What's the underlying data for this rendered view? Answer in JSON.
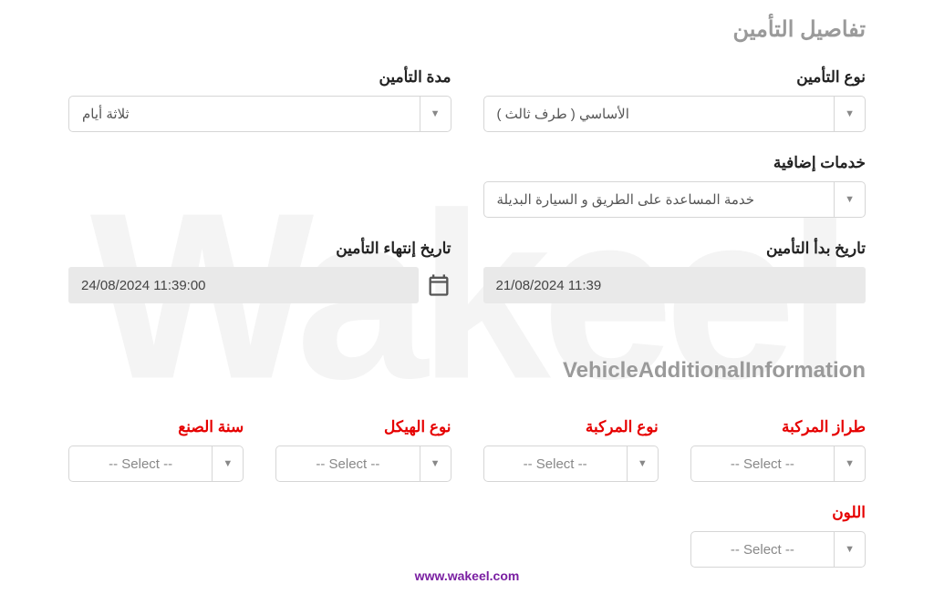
{
  "watermark": "Wakeel",
  "section1_title": "تفاصيل التأمين",
  "insurance_type": {
    "label": "نوع التأمين",
    "value": "الأساسي ( طرف ثالث )"
  },
  "insurance_duration": {
    "label": "مدة التأمين",
    "value": "ثلاثة أيام"
  },
  "additional_services": {
    "label": "خدمات إضافية",
    "value": "خدمة المساعدة على الطريق و السيارة البديلة"
  },
  "start_date": {
    "label": "تاريخ بدأ التأمين",
    "value": "11:39 21/08/2024"
  },
  "end_date": {
    "label": "تاريخ إنتهاء التأمين",
    "value": "11:39:00 24/08/2024"
  },
  "section2_title": "VehicleAdditionalInformation",
  "vehicle_model": {
    "label": "طراز المركبة",
    "placeholder": "-- Select --"
  },
  "vehicle_type": {
    "label": "نوع المركبة",
    "placeholder": "-- Select --"
  },
  "body_type": {
    "label": "نوع الهيكل",
    "placeholder": "-- Select --"
  },
  "manufacture_year": {
    "label": "سنة الصنع",
    "placeholder": "-- Select --"
  },
  "color": {
    "label": "اللون",
    "placeholder": "-- Select --"
  },
  "footer_url": "www.wakeel.com"
}
